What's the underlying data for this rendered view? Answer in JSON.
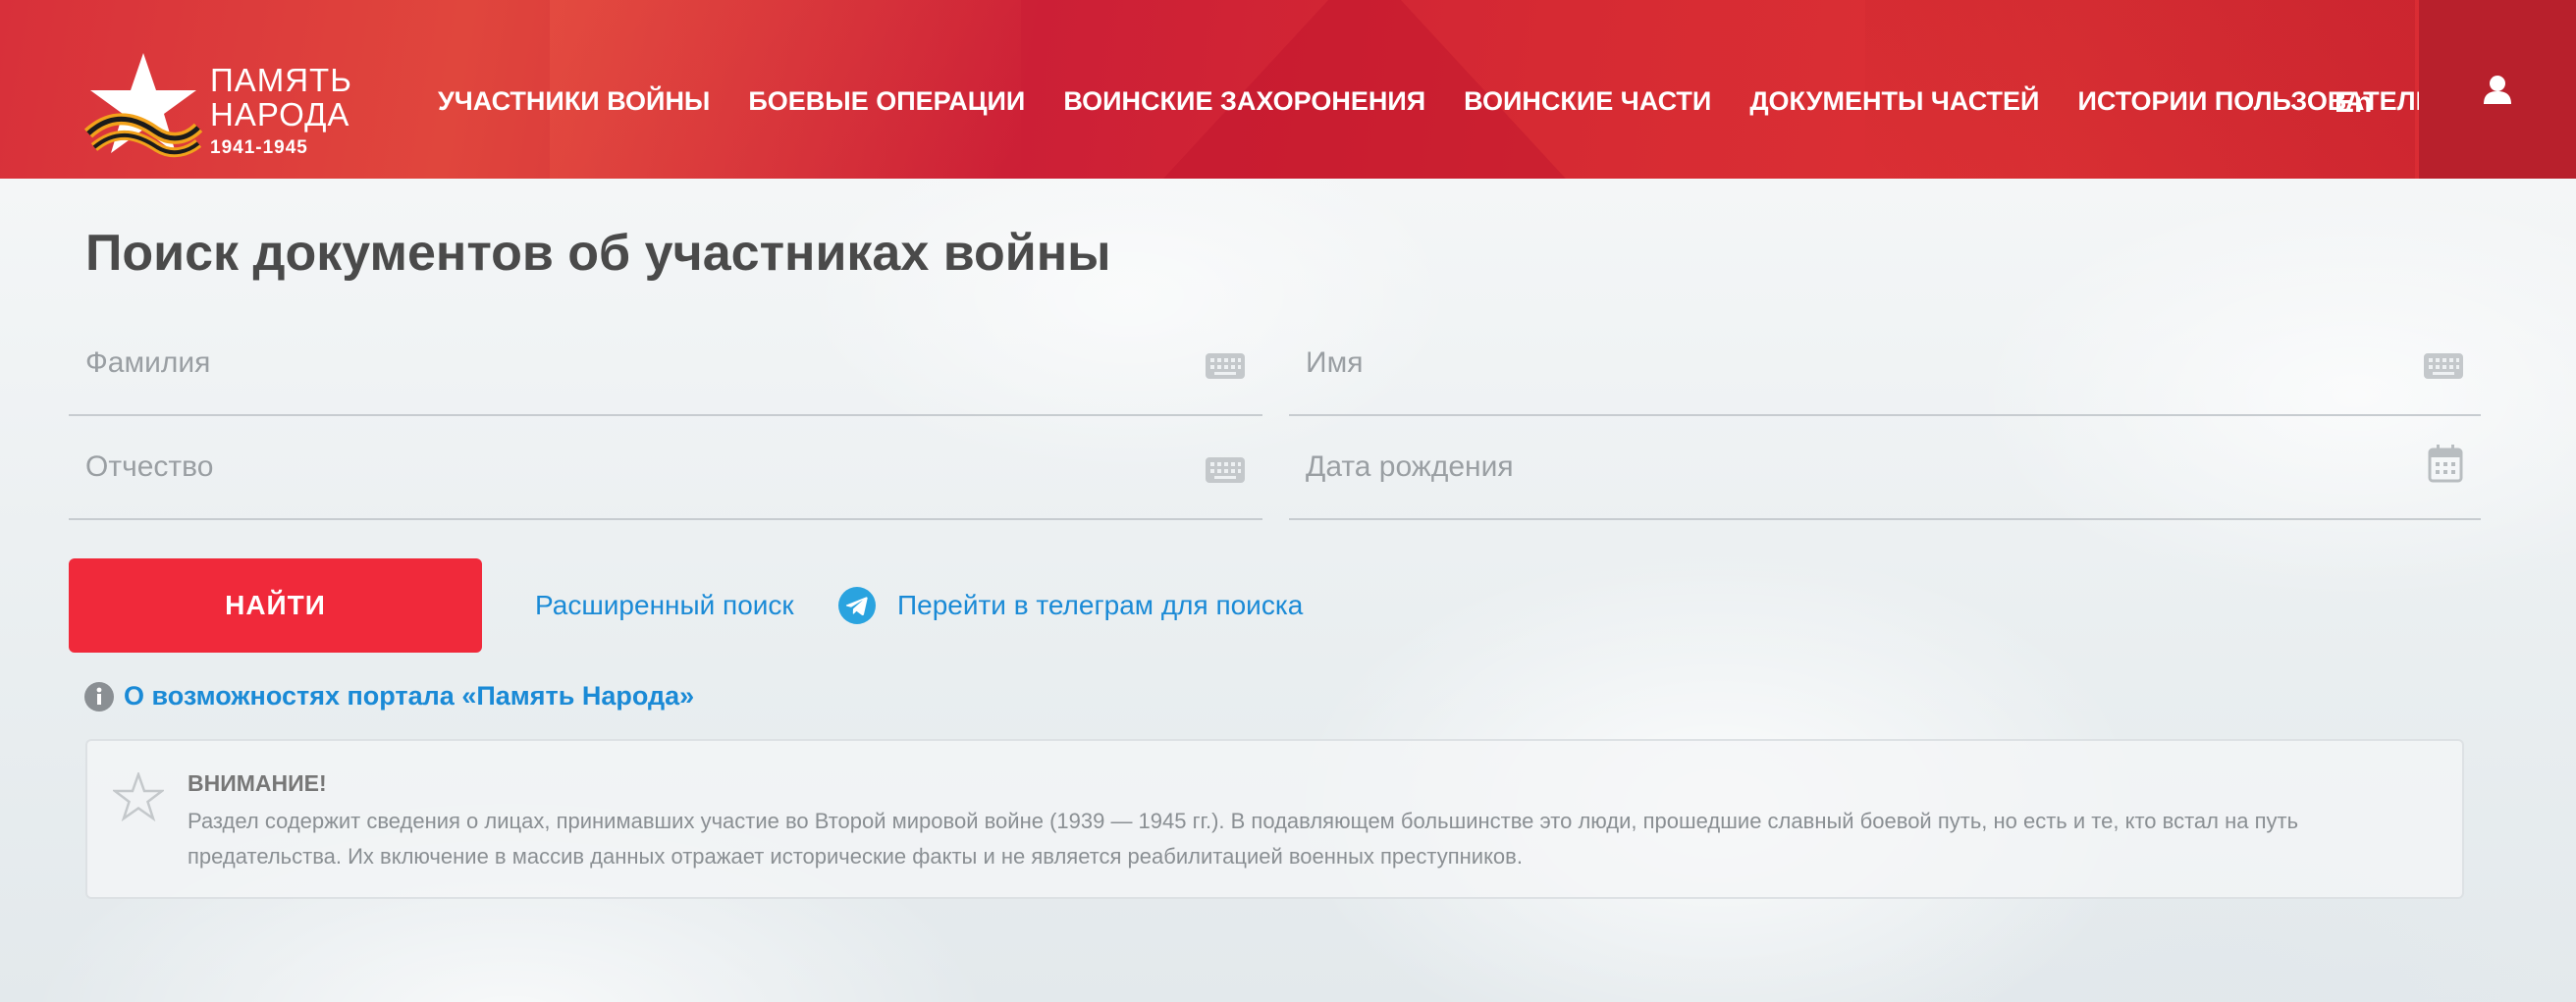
{
  "header": {
    "logo": {
      "line1": "ПАМЯТЬ",
      "line2": "НАРОДА",
      "years": "1941-1945"
    },
    "nav": [
      {
        "label": "УЧАСТНИКИ ВОЙНЫ"
      },
      {
        "label": "БОЕВЫЕ ОПЕРАЦИИ"
      },
      {
        "label": "ВОИНСКИЕ ЗАХОРОНЕНИЯ"
      },
      {
        "label": "ВОИНСКИЕ ЧАСТИ"
      },
      {
        "label": "ДОКУМЕНТЫ ЧАСТЕЙ"
      },
      {
        "label": "ИСТОРИИ ПОЛЬЗОВАТЕЛЕЙ"
      }
    ],
    "lang": "En",
    "user_icon": "user-icon",
    "colors": {
      "primary": "#d8303a",
      "user_area": "#b8202c"
    }
  },
  "page": {
    "title": "Поиск документов об участниках войны"
  },
  "form": {
    "surname": {
      "placeholder": "Фамилия",
      "value": "",
      "icon": "keyboard-icon"
    },
    "name": {
      "placeholder": "Имя",
      "value": "",
      "icon": "keyboard-icon"
    },
    "patronymic": {
      "placeholder": "Отчество",
      "value": "",
      "icon": "keyboard-icon"
    },
    "birthdate": {
      "placeholder": "Дата рождения",
      "value": "",
      "icon": "calendar-icon"
    },
    "search_label": "НАЙТИ",
    "advanced_link": "Расширенный поиск",
    "telegram_link": "Перейти в телеграм для поиска",
    "colors": {
      "button": "#f0293a",
      "link": "#1a8ad6"
    }
  },
  "info": {
    "icon": "info-icon",
    "link": "О возможностях портала «Память Народа»"
  },
  "notice": {
    "icon": "star-icon",
    "title": "ВНИМАНИЕ!",
    "text": "Раздел содержит сведения о лицах, принимавших участие во Второй мировой войне (1939 — 1945 гг.). В подавляющем большинстве это люди, прошедшие славный боевой путь, но есть и те, кто встал на путь предательства. Их включение в массив данных отражает исторические факты и не является реабилитацией военных преступников."
  }
}
